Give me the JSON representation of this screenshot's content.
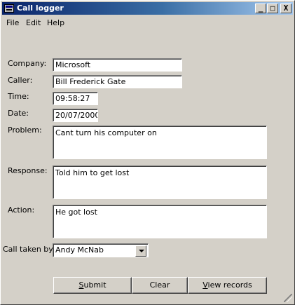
{
  "window": {
    "title": "Call logger",
    "controls": {
      "minimize": "_",
      "maximize": "□",
      "close": "X"
    }
  },
  "menu": [
    "File",
    "Edit",
    "Help"
  ],
  "form": {
    "company_label": "Company:",
    "company_value": "Microsoft",
    "caller_label": "Caller:",
    "caller_value": "Bill Frederick Gate",
    "time_label": "Time:",
    "time_value": "09:58:27",
    "date_label": "Date:",
    "date_value": "20/07/2000",
    "problem_label": "Problem:",
    "problem_value": "Cant turn his computer on",
    "response_label": "Response:",
    "response_value": "Told him to get lost",
    "action_label": "Action:",
    "action_value": "He got lost",
    "taken_by_label": "Call taken by:",
    "taken_by_value": "Andy McNab"
  },
  "buttons": {
    "submit_first": "S",
    "submit_rest": "ubmit",
    "clear": "Clear",
    "view_first": "V",
    "view_rest": "iew records"
  }
}
